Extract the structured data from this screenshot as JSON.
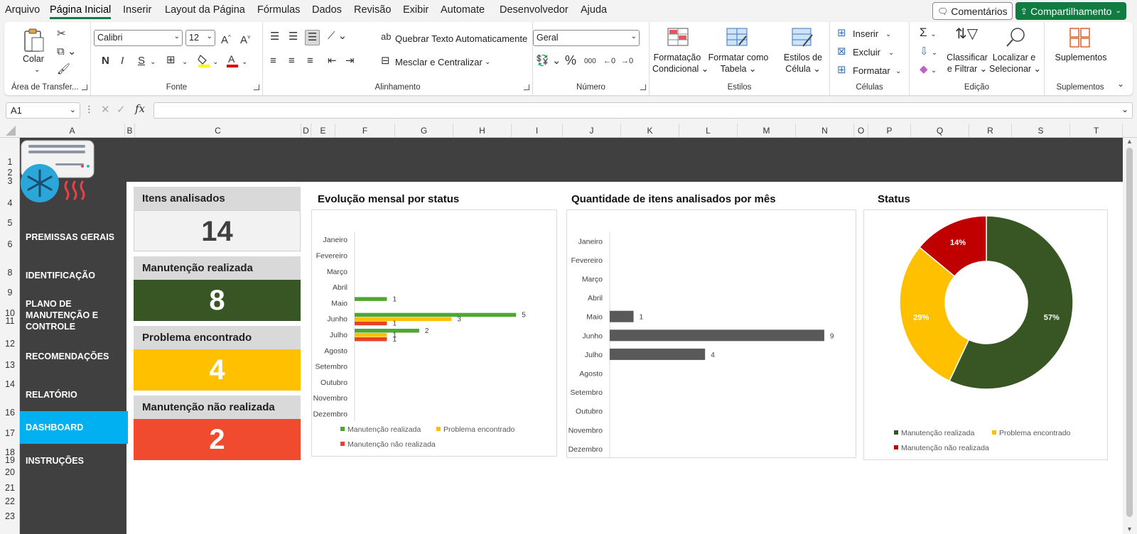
{
  "menu": {
    "tabs": [
      "Arquivo",
      "Página Inicial",
      "Inserir",
      "Layout da Página",
      "Fórmulas",
      "Dados",
      "Revisão",
      "Exibir",
      "Automate",
      "Desenvolvedor",
      "Ajuda"
    ],
    "comments": "Comentários",
    "share": "Compartilhamento"
  },
  "ribbon": {
    "clipboard": {
      "paste": "Colar",
      "label": "Área de Transfer..."
    },
    "font": {
      "name": "Calibri",
      "size": "12",
      "bold": "N",
      "italic": "I",
      "underline": "S",
      "label": "Fonte"
    },
    "alignment": {
      "wrap": "Quebrar Texto Automaticamente",
      "merge": "Mesclar e Centralizar",
      "label": "Alinhamento"
    },
    "number": {
      "format": "Geral",
      "label": "Número"
    },
    "styles": {
      "cond1": "Formatação",
      "cond2": "Condicional",
      "table1": "Formatar como",
      "table2": "Tabela",
      "cell1": "Estilos de",
      "cell2": "Célula",
      "label": "Estilos"
    },
    "cells": {
      "insert": "Inserir",
      "delete": "Excluir",
      "format": "Formatar",
      "label": "Células"
    },
    "editing": {
      "sort1": "Classificar",
      "sort2": "e Filtrar",
      "find1": "Localizar e",
      "find2": "Selecionar",
      "label": "Edição"
    },
    "addins": {
      "button": "Suplementos",
      "label": "Suplementos"
    }
  },
  "formula_bar": {
    "name_box": "A1",
    "fx": "fx",
    "content": ""
  },
  "columns": [
    "A",
    "B",
    "C",
    "D",
    "E",
    "F",
    "G",
    "H",
    "I",
    "J",
    "K",
    "L",
    "M",
    "N",
    "O",
    "P",
    "Q",
    "R",
    "S",
    "T"
  ],
  "rows": [
    "1",
    "2",
    "3",
    "4",
    "5",
    "6",
    "8",
    "9",
    "10",
    "11",
    "12",
    "13",
    "14",
    "16",
    "17",
    "18",
    "19",
    "20",
    "21",
    "22",
    "23"
  ],
  "sidebar": {
    "items": [
      "PREMISSAS GERAIS",
      "IDENTIFICAÇÃO",
      "PLANO DE MANUTENÇÃO E CONTROLE",
      "RECOMENDAÇÕES",
      "RELATÓRIO",
      "DASHBOARD",
      "INSTRUÇÕES"
    ],
    "active": "DASHBOARD"
  },
  "kpis": [
    {
      "label": "Itens analisados",
      "value": "14",
      "color": "#f2f2f2",
      "text_color": "#404040"
    },
    {
      "label": "Manutenção realizada",
      "value": "8",
      "color": "#375623",
      "text_color": "#ffffff"
    },
    {
      "label": "Problema encontrado",
      "value": "4",
      "color": "#ffc000",
      "text_color": "#ffffff"
    },
    {
      "label": "Manutenção não realizada",
      "value": "2",
      "color": "#f04a2f",
      "text_color": "#ffffff"
    }
  ],
  "chart_data": [
    {
      "type": "bar",
      "orientation": "horizontal",
      "title": "Evolução mensal por status",
      "categories": [
        "Janeiro",
        "Fevereiro",
        "Março",
        "Abril",
        "Maio",
        "Junho",
        "Julho",
        "Agosto",
        "Setembro",
        "Outubro",
        "Novembro",
        "Dezembro"
      ],
      "series": [
        {
          "name": "Manutenção realizada",
          "color": "#4ea72e",
          "values": [
            0,
            0,
            0,
            0,
            1,
            5,
            2,
            0,
            0,
            0,
            0,
            0
          ]
        },
        {
          "name": "Problema encontrado",
          "color": "#ffc000",
          "values": [
            0,
            0,
            0,
            0,
            0,
            3,
            1,
            0,
            0,
            0,
            0,
            0
          ]
        },
        {
          "name": "Manutenção não realizada",
          "color": "#e8412c",
          "values": [
            0,
            0,
            0,
            0,
            0,
            1,
            1,
            0,
            0,
            0,
            0,
            0
          ]
        }
      ],
      "xlim": [
        0,
        5.5
      ],
      "legend": "bottom"
    },
    {
      "type": "bar",
      "orientation": "horizontal",
      "title": "Quantidade de itens analisados por mês",
      "categories": [
        "Janeiro",
        "Fevereiro",
        "Março",
        "Abril",
        "Maio",
        "Junho",
        "Julho",
        "Agosto",
        "Setembro",
        "Outubro",
        "Novembro",
        "Dezembro"
      ],
      "values": [
        0,
        0,
        0,
        0,
        1,
        9,
        4,
        0,
        0,
        0,
        0,
        0
      ],
      "color": "#595959",
      "xlim": [
        0,
        9.3
      ]
    },
    {
      "type": "pie",
      "donut": true,
      "title": "Status",
      "labels": [
        "Manutenção realizada",
        "Problema encontrado",
        "Manutenção não realizada"
      ],
      "values": [
        57,
        29,
        14
      ],
      "value_labels": [
        "57%",
        "29%",
        "14%"
      ],
      "colors": [
        "#375623",
        "#ffc000",
        "#c00000"
      ],
      "legend": "bottom"
    }
  ]
}
